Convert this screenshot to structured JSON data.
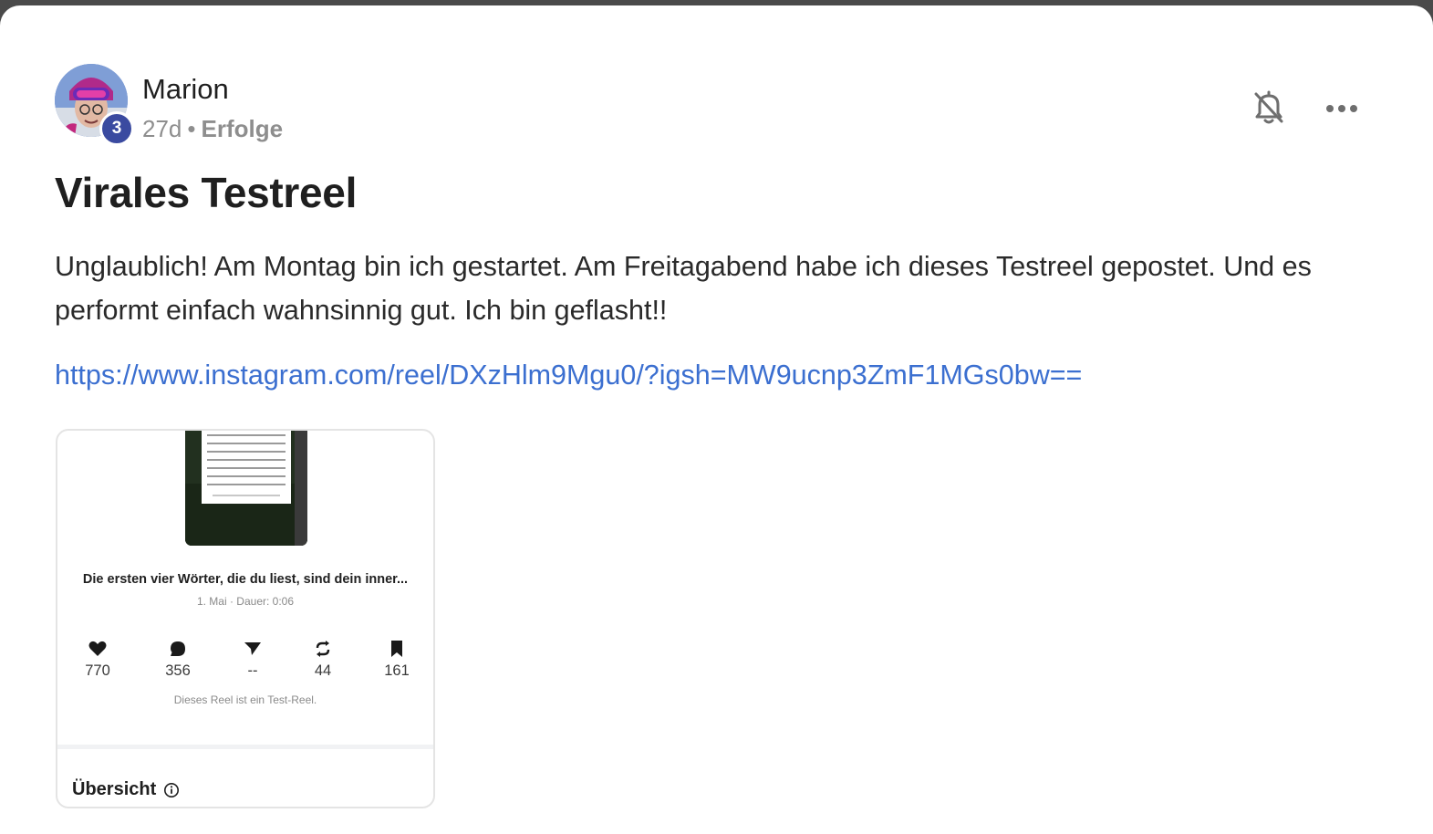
{
  "post": {
    "author": "Marion",
    "level": "3",
    "age": "27d",
    "separator": "•",
    "category": "Erfolge",
    "title": "Virales Testreel",
    "body": "Unglaublich! Am Montag bin ich gestartet. Am Freitagabend habe ich dieses Testreel gepostet. Und es performt einfach wahnsinnig gut. Ich bin geflasht!!",
    "link": "https://www.instagram.com/reel/DXzHlm9Mgu0/?igsh=MW9ucnp3ZmF1MGs0bw=="
  },
  "actions": {
    "notification_icon": "bell-off-icon",
    "more_icon": "more-horizontal-icon"
  },
  "preview": {
    "caption": "Die ersten vier Wörter, die du liest, sind dein inner...",
    "meta": "1. Mai · Dauer: 0:06",
    "stats": {
      "likes": "770",
      "comments": "356",
      "shares": "--",
      "reposts": "44",
      "saves": "161"
    },
    "note": "Dieses Reel ist ein Test-Reel.",
    "overview_label": "Übersicht"
  },
  "colors": {
    "link": "#3b6fd0",
    "badge": "#3a4aa0",
    "text": "#1f1f1f",
    "muted": "#8e8e8e"
  }
}
